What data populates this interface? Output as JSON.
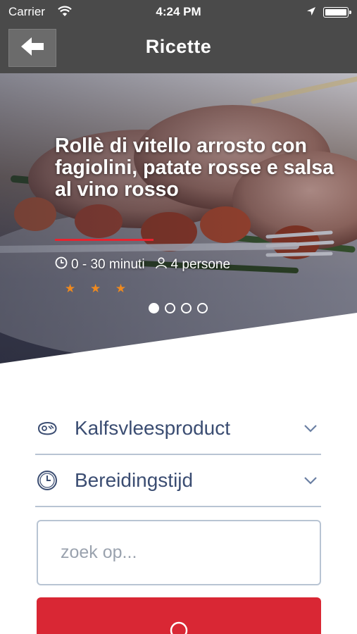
{
  "status_bar": {
    "carrier": "Carrier",
    "time": "4:24 PM",
    "icons": [
      "wifi-icon",
      "location-arrow-icon",
      "battery-icon"
    ]
  },
  "nav": {
    "title": "Ricette",
    "back_icon": "arrow-left-icon"
  },
  "hero": {
    "title": "Rollè di vitello arrosto con fagiolini, patate rosse e salsa al vino rosso",
    "time": "0 - 30 minuti",
    "persons": "4 persone",
    "stars": "★ ★ ★",
    "rating": 3,
    "slides_total": 4,
    "active_slide": 1
  },
  "filters": {
    "meat": {
      "label": "Kalfsvleesproduct",
      "icon": "meat-icon"
    },
    "time": {
      "label": "Bereidingstijd",
      "icon": "clock-icon"
    }
  },
  "search": {
    "placeholder": "zoek op...",
    "value": ""
  },
  "colors": {
    "bar": "#4a4a4a",
    "accent_red": "#d92734",
    "star_orange": "#f08a1e",
    "label_blue": "#3b4d72",
    "border": "#b8c4d3"
  }
}
